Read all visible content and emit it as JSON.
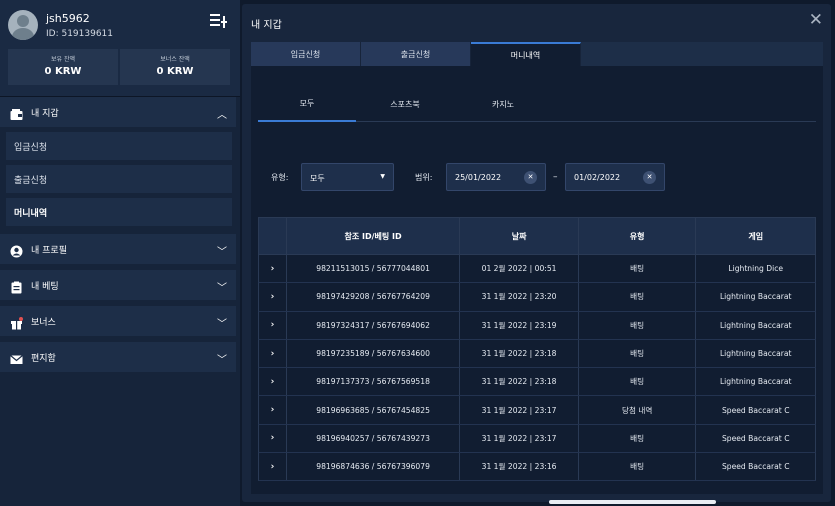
{
  "profile": {
    "username": "jsh5962",
    "user_id": "ID: 519139611",
    "balance_label": "보유 잔액",
    "balance_value": "0 KRW",
    "bonus_label": "보너스 잔액",
    "bonus_value": "0 KRW"
  },
  "sidebar": {
    "wallet": "내 지갑",
    "wallet_items": [
      "입금신청",
      "출금신청",
      "머니내역"
    ],
    "profile": "내 프로필",
    "betting": "내 베팅",
    "bonus": "보너스",
    "mailbox": "편지함"
  },
  "main": {
    "title": "내 지갑",
    "tabs": [
      "입금신청",
      "출금신청",
      "머니내역"
    ],
    "subtabs": [
      "모두",
      "스포츠북",
      "카지노"
    ],
    "filters": {
      "type_label": "유형:",
      "type_value": "모두",
      "range_label": "범위:",
      "date_from": "25/01/2022",
      "date_to": "01/02/2022",
      "separator": "–"
    },
    "table": {
      "headers": [
        "참조 ID/베팅 ID",
        "날짜",
        "유형",
        "게임"
      ],
      "rows": [
        [
          "98211513015 / 56777044801",
          "01 2월 2022 | 00:51",
          "배팅",
          "Lightning Dice"
        ],
        [
          "98197429208 / 56767764209",
          "31 1월 2022 | 23:20",
          "배팅",
          "Lightning Baccarat"
        ],
        [
          "98197324317 / 56767694062",
          "31 1월 2022 | 23:19",
          "배팅",
          "Lightning Baccarat"
        ],
        [
          "98197235189 / 56767634600",
          "31 1월 2022 | 23:18",
          "배팅",
          "Lightning Baccarat"
        ],
        [
          "98197137373 / 56767569518",
          "31 1월 2022 | 23:18",
          "배팅",
          "Lightning Baccarat"
        ],
        [
          "98196963685 / 56767454825",
          "31 1월 2022 | 23:17",
          "당첨 내역",
          "Speed Baccarat C"
        ],
        [
          "98196940257 / 56767439273",
          "31 1월 2022 | 23:17",
          "배팅",
          "Speed Baccarat C"
        ],
        [
          "98196874636 / 56767396079",
          "31 1월 2022 | 23:16",
          "배팅",
          "Speed Baccarat C"
        ]
      ]
    }
  },
  "colors": {
    "accent": "#3a7bd5",
    "panel": "#18263d",
    "sidebar": "#16243a"
  }
}
